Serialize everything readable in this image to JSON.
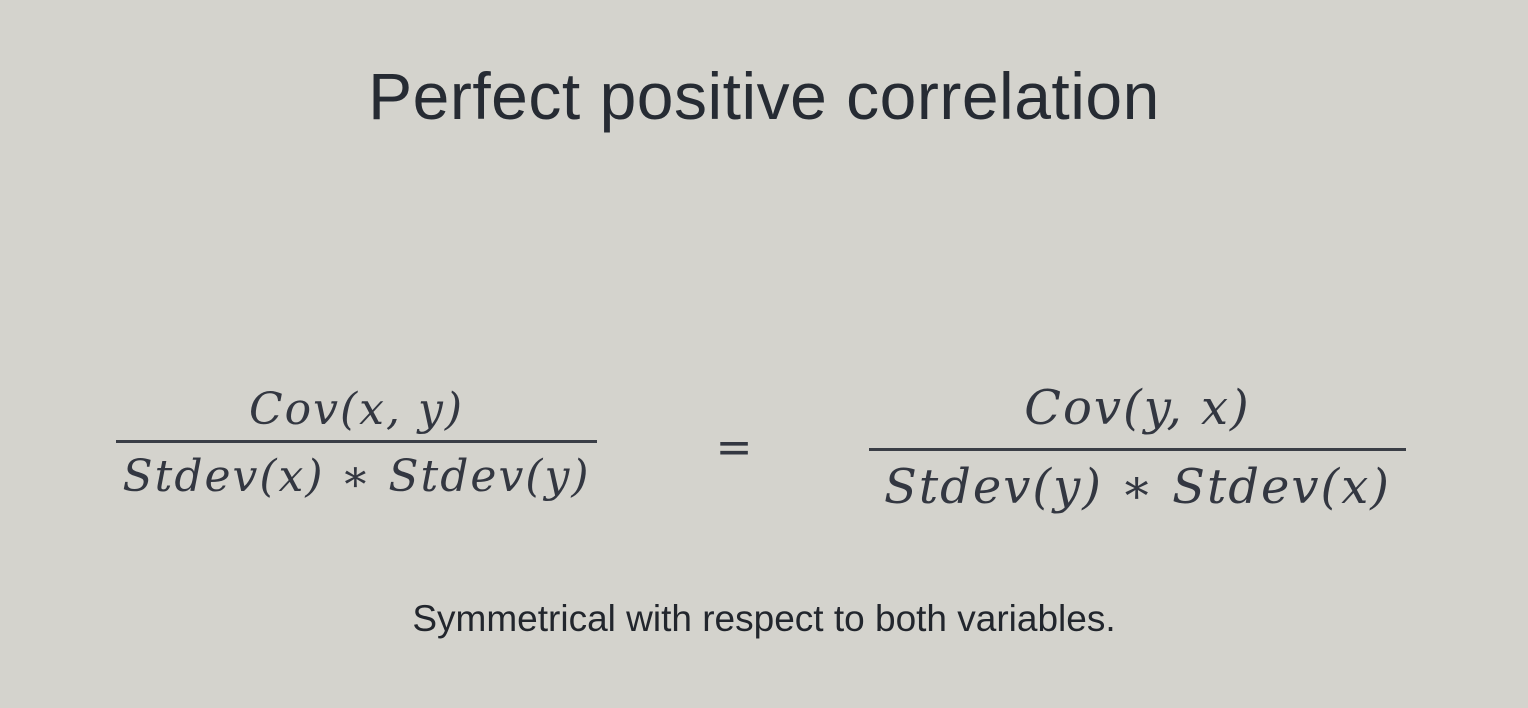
{
  "slide": {
    "title": "Perfect positive correlation",
    "formula": {
      "left": {
        "numerator": "Cov(x, y)",
        "denominator": "Stdev(x) ∗ Stdev(y)"
      },
      "operator": "=",
      "right": {
        "numerator": "Cov(y, x)",
        "denominator": "Stdev(y) ∗ Stdev(x)"
      }
    },
    "caption": "Symmetrical with respect to both variables."
  },
  "colors": {
    "background": "#d4d3cd",
    "text": "#2b2f36"
  }
}
